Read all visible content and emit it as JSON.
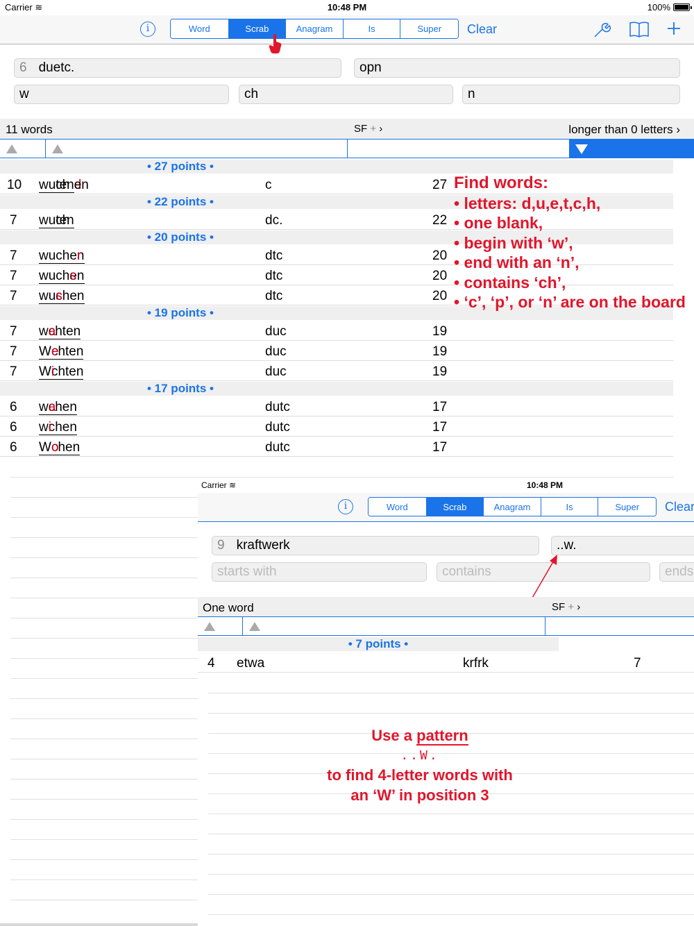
{
  "status": {
    "carrier": "Carrier",
    "time": "10:48 PM",
    "battery": "100%"
  },
  "toolbar": {
    "info_icon": "info-icon",
    "segments": [
      "Word",
      "Scrab",
      "Anagram",
      "Is",
      "Super"
    ],
    "active_segment": "Scrab",
    "clear_label": "Clear",
    "icons": [
      "wrench-icon",
      "book-icon",
      "plus-icon"
    ]
  },
  "fields": {
    "letters_count": "6",
    "letters_value": "duetc.",
    "board_value": "opn",
    "starts_with_value": "w",
    "contains_value": "ch",
    "ends_with_value": "n"
  },
  "results_header": {
    "count": "11 words",
    "sort_label": "SF",
    "sort_plus": "+",
    "filter": "longer than 0 letters"
  },
  "groups": [
    {
      "label": "• 27 points •",
      "rows": [
        {
          "len": "10",
          "pre": "wu",
          "mid": "ch",
          "post": "ten",
          "red": "d",
          "tail": "en",
          "tail_red": "",
          "extra": "c",
          "score": "27"
        }
      ]
    },
    {
      "label": "• 22 points •",
      "rows": [
        {
          "len": "7",
          "word": "wuchten",
          "extra": "dc.",
          "score": "22"
        }
      ]
    },
    {
      "label": "• 20 points •",
      "rows": [
        {
          "len": "7",
          "word": "wuchern",
          "extra": "dtc",
          "score": "20"
        },
        {
          "len": "7",
          "word": "wuchsen",
          "extra": "dtc",
          "score": "20"
        },
        {
          "len": "7",
          "word": "wuschen",
          "extra": "dtc",
          "score": "20"
        }
      ]
    },
    {
      "label": "• 19 points •",
      "rows": [
        {
          "len": "7",
          "word": "wachten",
          "extra": "duc",
          "score": "19"
        },
        {
          "len": "7",
          "word": "Wechten",
          "extra": "duc",
          "score": "19"
        },
        {
          "len": "7",
          "word": "Wichten",
          "extra": "duc",
          "score": "19"
        }
      ]
    },
    {
      "label": "• 17 points •",
      "rows": [
        {
          "len": "6",
          "word": "wachen",
          "extra": "dutc",
          "score": "17"
        },
        {
          "len": "6",
          "word": "wichen",
          "extra": "dutc",
          "score": "17"
        },
        {
          "len": "6",
          "word": "Wochen",
          "extra": "dutc",
          "score": "17"
        }
      ]
    }
  ],
  "annotation1": {
    "title": "Find words:",
    "items": [
      "• letters: d,u,e,t,c,h,",
      "• one blank,",
      "• begin with ‘w’,",
      "• end with an ‘n’,",
      "• contains ‘ch’,",
      "• ‘c’, ‘p’, or ‘n’ are on the board"
    ]
  },
  "shot2": {
    "status": {
      "carrier": "Carrier",
      "time": "10:48 PM"
    },
    "segments": [
      "Word",
      "Scrab",
      "Anagram",
      "Is",
      "Super"
    ],
    "active_segment": "Scrab",
    "clear_label": "Clear",
    "letters_count": "9",
    "letters_value": "kraftwerk",
    "pattern_value": "..w.",
    "starts_with_placeholder": "starts with",
    "contains_placeholder": "contains",
    "ends_placeholder": "ends",
    "count": "One word",
    "sort_label": "SF",
    "sort_plus": "+",
    "group_label": "• 7 points •",
    "row": {
      "len": "4",
      "word": "etwa",
      "extra": "krfrk",
      "score": "7"
    },
    "annotation": {
      "line1_pre": "Use a ",
      "line1_link": "pattern",
      "line2": "..W.",
      "line3": "to find 4-letter words with",
      "line4": "an ‘W’ in position 3"
    }
  },
  "colors": {
    "accent": "#1a73e8",
    "annotation": "#e0162b",
    "highlight": "#d0021b"
  }
}
